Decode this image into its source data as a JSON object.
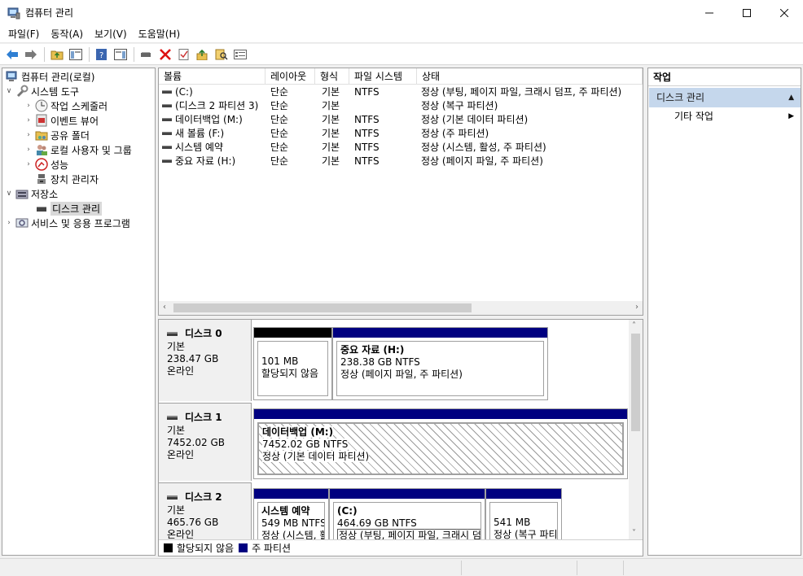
{
  "window": {
    "title": "컴퓨터 관리"
  },
  "menu": [
    "파일(F)",
    "동작(A)",
    "보기(V)",
    "도움말(H)"
  ],
  "tree": {
    "root": "컴퓨터 관리(로컬)",
    "system_tools": "시스템 도구",
    "task_scheduler": "작업 스케줄러",
    "event_viewer": "이벤트 뷰어",
    "shared_folders": "공유 폴더",
    "local_users": "로컬 사용자 및 그룹",
    "performance": "성능",
    "device_manager": "장치 관리자",
    "storage": "저장소",
    "disk_management": "디스크 관리",
    "services": "서비스 및 응용 프로그램"
  },
  "volume_table": {
    "headers": [
      "볼륨",
      "레이아웃",
      "형식",
      "파일 시스템",
      "상태"
    ],
    "rows": [
      [
        "(C:)",
        "단순",
        "기본",
        "NTFS",
        "정상 (부팅, 페이지 파일, 크래시 덤프, 주 파티션)"
      ],
      [
        "(디스크 2 파티션 3)",
        "단순",
        "기본",
        "",
        "정상 (복구 파티션)"
      ],
      [
        "데이터백업 (M:)",
        "단순",
        "기본",
        "NTFS",
        "정상 (기본 데이터 파티션)"
      ],
      [
        "새 볼륨 (F:)",
        "단순",
        "기본",
        "NTFS",
        "정상 (주 파티션)"
      ],
      [
        "시스템 예약",
        "단순",
        "기본",
        "NTFS",
        "정상 (시스템, 활성, 주 파티션)"
      ],
      [
        "중요 자료 (H:)",
        "단순",
        "기본",
        "NTFS",
        "정상 (페이지 파일, 주 파티션)"
      ]
    ]
  },
  "disks": [
    {
      "name": "디스크 0",
      "type": "기본",
      "size": "238.47 GB",
      "status": "온라인",
      "partitions": [
        {
          "title": "",
          "size": "101 MB",
          "status": "할당되지 않음"
        },
        {
          "title": "중요 자료  (H:)",
          "size": "238.38 GB NTFS",
          "status": "정상 (페이지 파일, 주 파티션)"
        }
      ]
    },
    {
      "name": "디스크 1",
      "type": "기본",
      "size": "7452.02 GB",
      "status": "온라인",
      "partitions": [
        {
          "title": "데이터백업  (M:)",
          "size": "7452.02 GB NTFS",
          "status": "정상 (기본 데이터 파티션)"
        }
      ]
    },
    {
      "name": "디스크 2",
      "type": "기본",
      "size": "465.76 GB",
      "status": "온라인",
      "partitions": [
        {
          "title": "시스템 예약",
          "size": "549 MB NTFS",
          "status": "정상 (시스템, 활"
        },
        {
          "title": "(C:)",
          "size": "464.69 GB NTFS",
          "status": "정상 (부팅, 페이지 파일, 크래시 덤프, 주 파티션)"
        },
        {
          "title": "",
          "size": "541 MB",
          "status": "정상 (복구 파티션)"
        }
      ]
    }
  ],
  "legend": {
    "unallocated": "할당되지 않음",
    "primary": "주 파티션"
  },
  "actions": {
    "title": "작업",
    "group": "디스크 관리",
    "item": "기타 작업"
  },
  "colors": {
    "primary_partition": "#000080",
    "unallocated": "#000000",
    "action_group": "#c5d7ec"
  }
}
